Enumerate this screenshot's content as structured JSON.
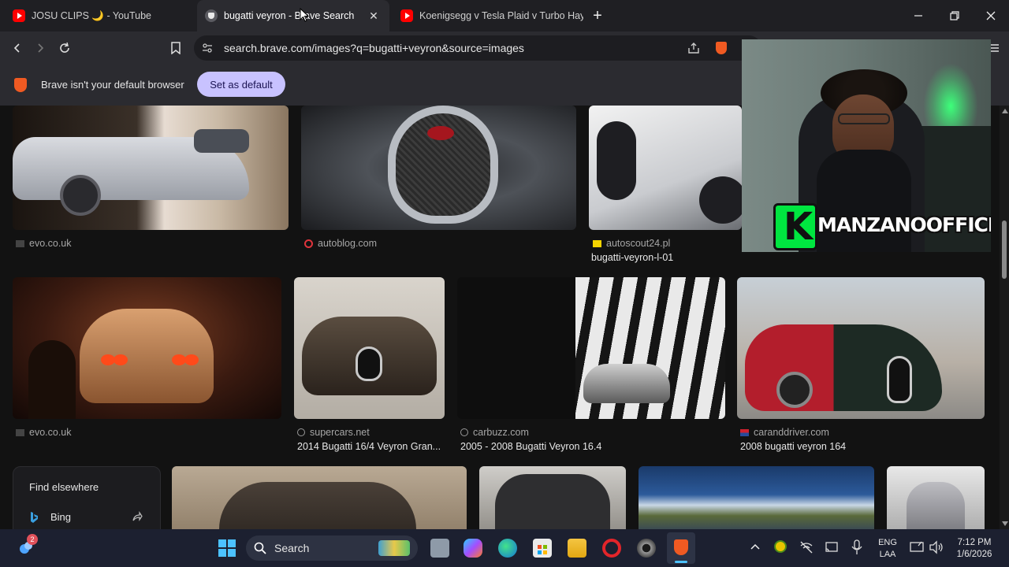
{
  "tabs": [
    {
      "title": "JOSU CLIPS 🌙 - YouTube"
    },
    {
      "title": "bugatti veyron - Brave Search"
    },
    {
      "title": "Koenigsegg v Tesla Plaid v Turbo Hay"
    }
  ],
  "toolbar": {
    "url": "search.brave.com/images?q=bugatti+veyron&source=images"
  },
  "infobar": {
    "message": "Brave isn't your default browser",
    "button": "Set as default"
  },
  "results": {
    "row1": [
      {
        "source": "evo.co.uk",
        "caption": ""
      },
      {
        "source": "autoblog.com",
        "caption": ""
      },
      {
        "source": "autoscout24.pl",
        "caption": "bugatti-veyron-l-01"
      }
    ],
    "row2": [
      {
        "source": "evo.co.uk",
        "caption": ""
      },
      {
        "source": "supercars.net",
        "caption": "2014 Bugatti 16/4 Veyron Gran..."
      },
      {
        "source": "carbuzz.com",
        "caption": "2005 - 2008 Bugatti Veyron 16.4"
      },
      {
        "source": "caranddriver.com",
        "caption": "2008 bugatti veyron 164"
      }
    ],
    "find_elsewhere": {
      "title": "Find elsewhere",
      "engine": "Bing"
    }
  },
  "overlay": {
    "badge_letter": "K",
    "channel": "MANZANOOFFICIAL"
  },
  "taskbar": {
    "search": "Search",
    "notification_count": "2",
    "lang_top": "ENG",
    "lang_bottom": "LAA",
    "time": "7:12 PM",
    "date": "1/6/2026"
  },
  "colors": {
    "accent_button": "#c8c2ff",
    "brave_orange": "#f05a22",
    "taskbar": "#1c2030"
  }
}
